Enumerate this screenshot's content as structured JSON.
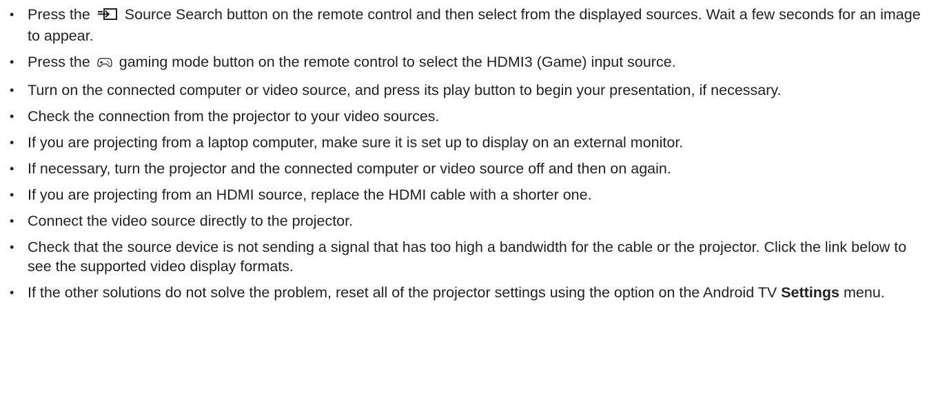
{
  "items": [
    {
      "before": "Press the",
      "icon": "source-search-icon",
      "after": "Source Search button on the remote control and then select from the displayed sources. Wait a few seconds for an image to appear."
    },
    {
      "before": "Press the",
      "icon": "gamepad-icon",
      "after": "gaming mode button on the remote control to select the HDMI3 (Game) input source."
    },
    {
      "text": "Turn on the connected computer or video source, and press its play button to begin your presentation, if necessary."
    },
    {
      "text": "Check the connection from the projector to your video sources."
    },
    {
      "text": "If you are projecting from a laptop computer, make sure it is set up to display on an external monitor."
    },
    {
      "text": "If necessary, turn the projector and the connected computer or video source off and then on again."
    },
    {
      "text": "If you are projecting from an HDMI source, replace the HDMI cable with a shorter one."
    },
    {
      "text": "Connect the video source directly to the projector."
    },
    {
      "text": "Check that the source device is not sending a signal that has too high a bandwidth for the cable or the projector. Click the link below to see the supported video display formats."
    },
    {
      "before": "If the other solutions do not solve the problem, reset all of the projector settings using the option on the Android TV",
      "bold": "Settings",
      "after": "menu."
    }
  ],
  "bullet_char": "•"
}
